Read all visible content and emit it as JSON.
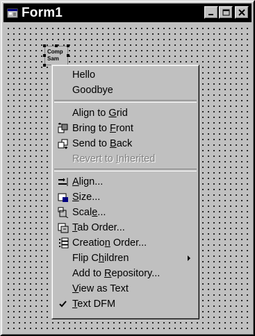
{
  "window": {
    "title": "Form1"
  },
  "component": {
    "line1": "Comp",
    "line2": "Sam"
  },
  "menu": {
    "items": [
      {
        "label": "Hello"
      },
      {
        "label": "Goodbye"
      },
      {
        "label": "Align to Grid",
        "ul": "G"
      },
      {
        "label": "Bring to Front",
        "ul": "F",
        "icon": "bring-to-front-icon"
      },
      {
        "label": "Send to Back",
        "ul": "B",
        "icon": "send-to-back-icon"
      },
      {
        "label": "Revert to Inherited",
        "ul": "I",
        "disabled": true
      },
      {
        "label": "Align...",
        "ul": "A",
        "icon": "align-icon"
      },
      {
        "label": "Size...",
        "ul": "S",
        "icon": "size-icon"
      },
      {
        "label": "Scale...",
        "ul": "e",
        "icon": "scale-icon"
      },
      {
        "label": "Tab Order...",
        "ul": "T",
        "icon": "tab-order-icon"
      },
      {
        "label": "Creation Order...",
        "ul": "n",
        "icon": "creation-order-icon"
      },
      {
        "label": "Flip Children",
        "ul": "h",
        "submenu": true
      },
      {
        "label": "Add to Repository...",
        "ul": "R"
      },
      {
        "label": "View as Text",
        "ul": "V"
      },
      {
        "label": "Text DFM",
        "ul": "T",
        "checked": true,
        "icon": "checkmark-icon"
      }
    ]
  }
}
